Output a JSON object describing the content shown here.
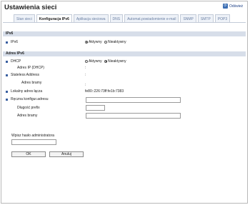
{
  "page": {
    "title": "Ustawienia sieci",
    "refresh_label": "Odśwież"
  },
  "tabs": [
    {
      "label": "Stan sieci"
    },
    {
      "label": "Konfiguracja IPv6"
    },
    {
      "label": "Aplikacja sieciowa"
    },
    {
      "label": "DNS"
    },
    {
      "label": "Automat.powiadomienie e-mail"
    },
    {
      "label": "SNMP"
    },
    {
      "label": "SMTP"
    },
    {
      "label": "POP3"
    }
  ],
  "ipv6_section": {
    "header": "IPv6",
    "ipv6_label": "IPv6",
    "opt_active": "Aktywny",
    "opt_inactive": "Nieaktywny"
  },
  "address_section": {
    "header": "Adres IPv6",
    "dhcp_label": "DHCP",
    "dhcp_opt_active": "Aktywny",
    "dhcp_opt_inactive": "Nieaktywny",
    "dhcp_address_label": "Adres IP (DHCP)",
    "dhcp_address_value": ":",
    "stateless_label": "Stateless Address",
    "stateless_value": ":",
    "gateway_label_1": "Adres bramy",
    "gateway_value_1": ":",
    "link_local_label": "Lokalny adres łącza",
    "link_local_value": "fe80::226:73ff:fe1b:7383",
    "manual_label": "Ręczna konfigur.adresu",
    "prefix_label": "Długość prefix",
    "gateway_label_2": "Adres bramy"
  },
  "admin": {
    "label": "Wpisz hasło administratora"
  },
  "buttons": {
    "ok": "OK",
    "cancel": "Anuluj"
  }
}
